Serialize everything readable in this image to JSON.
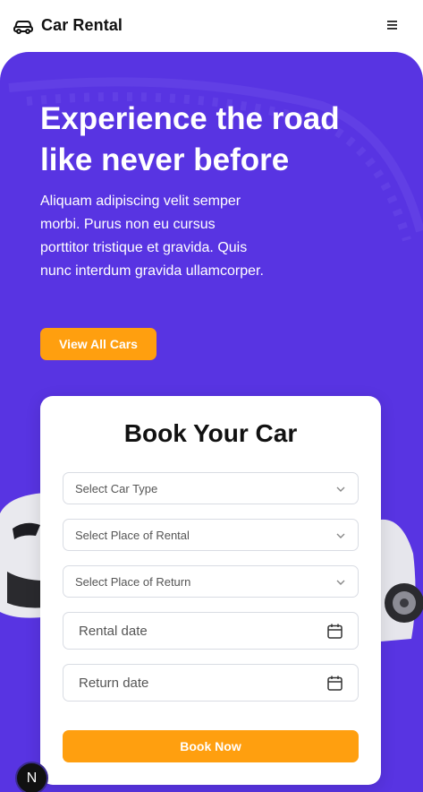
{
  "header": {
    "brand_name": "Car Rental",
    "brand_icon": "car-icon",
    "menu_icon": "hamburger-icon"
  },
  "hero": {
    "title": "Experience the road like never before",
    "text": "Aliquam adipiscing velit semper morbi. Purus non eu cursus porttitor tristique et gravida. Quis nunc interdum gravida ullamcorper.",
    "cta_label": "View All Cars",
    "background_color": "#5834e2",
    "accent_color": "#ff9f0f"
  },
  "booking": {
    "title": "Book Your Car",
    "car_type_placeholder": "Select Car Type",
    "rental_place_placeholder": "Select Place of Rental",
    "return_place_placeholder": "Select Place of Return",
    "rental_date_placeholder": "Rental date",
    "return_date_placeholder": "Return date",
    "submit_label": "Book Now"
  },
  "badge": {
    "letter": "N"
  }
}
